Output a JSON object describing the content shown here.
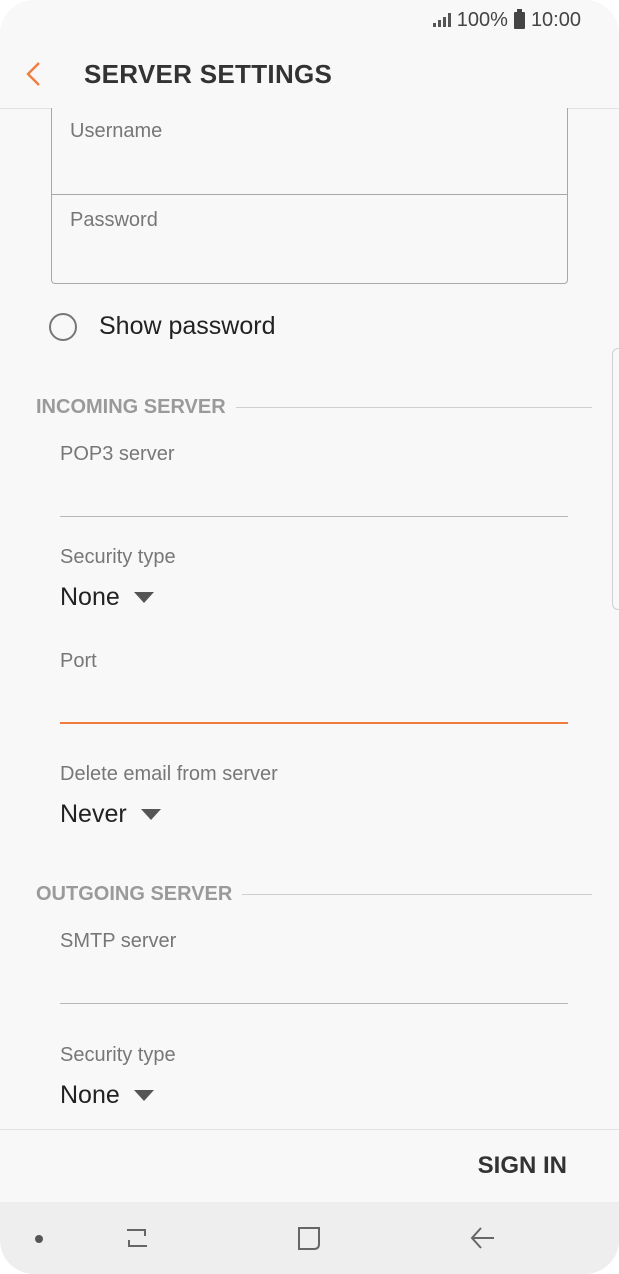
{
  "status_bar": {
    "battery": "100%",
    "time": "10:00"
  },
  "app_bar": {
    "title": "SERVER SETTINGS"
  },
  "credentials": {
    "username_label": "Username",
    "password_label": "Password"
  },
  "show_password": {
    "label": "Show password",
    "checked": false
  },
  "incoming": {
    "header": "INCOMING SERVER",
    "server_label": "POP3 server",
    "security_label": "Security type",
    "security_value": "None",
    "port_label": "Port",
    "delete_label": "Delete email from server",
    "delete_value": "Never"
  },
  "outgoing": {
    "header": "OUTGOING SERVER",
    "server_label": "SMTP server",
    "security_label": "Security type",
    "security_value": "None"
  },
  "actions": {
    "sign_in": "SIGN IN"
  },
  "colors": {
    "accent": "#f07d3e",
    "text": "#222222",
    "muted": "#777777"
  },
  "icons": [
    "back-arrow-icon",
    "radio-icon",
    "caret-down-icon",
    "recents-icon",
    "home-icon",
    "back-nav-icon"
  ]
}
